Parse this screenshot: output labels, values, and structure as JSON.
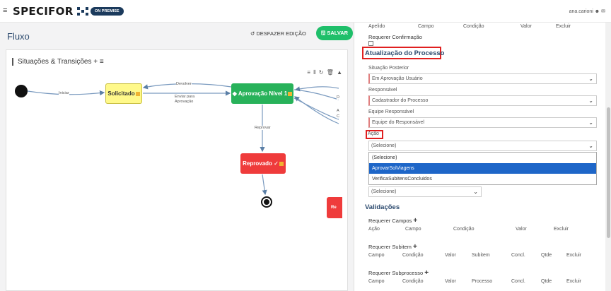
{
  "header": {
    "brand": "SPECIFOR",
    "badge": "ON PREMISE",
    "user": "ana.carioni"
  },
  "left": {
    "title": "Fluxo",
    "undo_label": "DESFAZER EDIÇÃO",
    "save_label": "SALVAR",
    "card_title": "Situações & Transições",
    "card_title_actions": "+ ≡",
    "toolbar_icons": "≡ ⫴ ↻ 🗑 ▲",
    "nodes": {
      "solicitado": "Solicitado",
      "aprovacao": "Aprovação Nível 1",
      "reprovado": "Reprovado",
      "partial": "Re"
    },
    "edges": {
      "iniciar": "Iniciar",
      "devolver": "Devolver",
      "enviar1": "Enviar para",
      "enviar2": "Aprovação",
      "reprovar": "Reprovar",
      "d": "D",
      "a": "A",
      "c": "C"
    }
  },
  "right": {
    "table_head": [
      "Apelido",
      "Campo",
      "Condição",
      "Valor",
      "Excluir"
    ],
    "requerer_confirmacao": "Requerer Confirmação",
    "section_atualizacao": "Atualização do Processo",
    "situacao_label": "Situação Posterior",
    "situacao_value": "Em Aprovação Usuário",
    "responsavel_label": "Responsável",
    "responsavel_value": "Cadastrador do Processo",
    "equipe_label": "Equipe Responsável",
    "equipe_value": "Equipe do Responsável",
    "acao_label": "Ação",
    "acao_value": "(Selecione)",
    "acao_options": [
      "(Selecione)",
      "AprovarSolViagens",
      "VerificaSubitensConcluidos"
    ],
    "hidden_select_value": "(Selecione)",
    "section_validacoes": "Validações",
    "requerer_campos": "Requerer Campos",
    "campos_cols": [
      "Ação",
      "Campo",
      "Condição",
      "Valor",
      "Excluir"
    ],
    "requerer_subitem": "Requerer Subitem",
    "subitem_cols": [
      "Campo",
      "Condição",
      "Valor",
      "Subitem",
      "Concl.",
      "Qtde",
      "Excluir"
    ],
    "requerer_subprocesso": "Requerer Subprocesso",
    "subprocesso_cols": [
      "Campo",
      "Condição",
      "Valor",
      "Processo",
      "Concl.",
      "Qtde",
      "Excluir"
    ]
  }
}
